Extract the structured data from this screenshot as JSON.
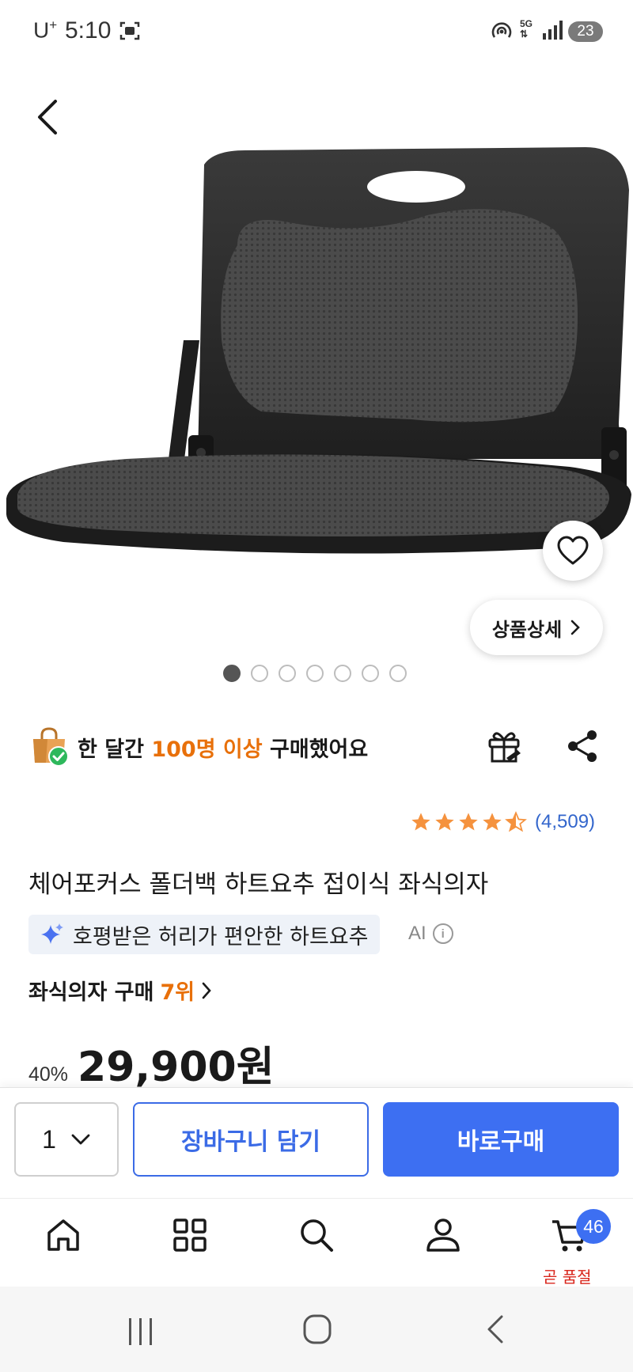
{
  "status_bar": {
    "carrier": "U",
    "carrier_sup": "+",
    "time": "5:10",
    "network": "5G",
    "battery": "23"
  },
  "product": {
    "purchase_notice": {
      "prefix": "한 달간 ",
      "highlight": "100명 이상",
      "suffix": " 구매했어요"
    },
    "rating": 4.5,
    "review_count": "(4,509)",
    "title": "체어포커스 폴더백 하트요추 접이식 좌식의자",
    "ai_summary": "호평받은 허리가 편안한 하트요추",
    "ai_label": "AI",
    "ranking": {
      "prefix": "좌식의자 구매",
      "rank": "7위"
    },
    "discount": "40%",
    "price": "29,900원",
    "detail_button": "상품상세",
    "image_count": 7,
    "current_image": 1
  },
  "action_bar": {
    "quantity": "1",
    "cart_button": "장바구니 담기",
    "buy_button": "바로구매"
  },
  "tab_bar": {
    "items": [
      "home-icon",
      "category-grid-icon",
      "search-icon",
      "user-icon",
      "cart-icon"
    ],
    "cart_badge": "46",
    "cart_status": "곧 품절"
  },
  "colors": {
    "accent_blue": "#3d6ff2",
    "highlight_orange": "#e8700a",
    "star": "#f5923e",
    "soldout_red": "#d9261c"
  }
}
